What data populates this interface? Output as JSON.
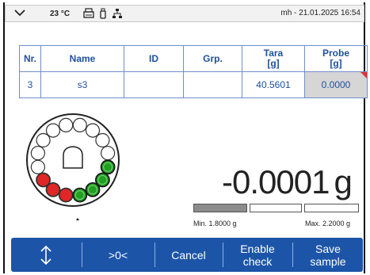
{
  "status_bar": {
    "temperature": "23 °C",
    "user_time": "mh - 21.01.2025 16:54",
    "icons": [
      "chevron-down-icon",
      "printer-icon",
      "usb-icon",
      "network-icon"
    ]
  },
  "table": {
    "headers": [
      "Nr.",
      "Name",
      "ID",
      "Grp.",
      "Tara\n[g]",
      "Probe\n[g]"
    ],
    "row": {
      "nr": "3",
      "name": "s3",
      "id": "",
      "grp": "",
      "tara": "40.5601",
      "probe": "0.0000"
    }
  },
  "sample_changer": {
    "position_count": 16,
    "states": {
      "green_positions": 4,
      "red_positions": 3
    },
    "pointer_icon": "up-arrow-icon"
  },
  "weight": {
    "value": "-0.0001",
    "unit": "g"
  },
  "tolerance": {
    "min_label": "Min. 1.8000 g",
    "max_label": "Max. 2.2000 g",
    "fill_fraction": 0.37
  },
  "actions": {
    "sort_icon": "up-down-arrow-icon",
    "zero_label": ">0<",
    "cancel_label": "Cancel",
    "enable_check_label": "Enable check",
    "save_sample_label": "Save sample"
  },
  "colors": {
    "accent": "#1c55a8",
    "table_text": "#1f4f9c",
    "green": "#1fa01f",
    "red": "#e02626"
  }
}
